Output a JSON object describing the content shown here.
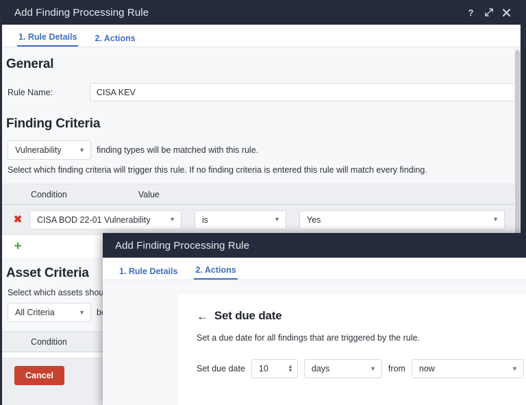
{
  "modal1": {
    "title": "Add Finding Processing Rule",
    "header_icons": [
      {
        "name": "help-icon",
        "glyph": "?"
      },
      {
        "name": "expand-icon",
        "glyph": "↗"
      },
      {
        "name": "close-icon",
        "glyph": "✖"
      }
    ],
    "tabs": [
      {
        "label": "1. Rule Details",
        "active": true
      },
      {
        "label": "2. Actions",
        "active": false
      }
    ],
    "general": {
      "heading": "General",
      "rule_name_label": "Rule Name:",
      "rule_name_value": "CISA KEV",
      "rule_name_placeholder": ""
    },
    "finding_criteria": {
      "heading": "Finding Criteria",
      "type_select": "Vulnerability",
      "type_suffix": "finding types will be matched with this rule.",
      "description": "Select which finding criteria will trigger this rule. If no finding criteria is entered this rule will match every finding.",
      "col_condition": "Condition",
      "col_value": "Value",
      "rows": [
        {
          "remove_label": "✖",
          "condition": "CISA BOD 22-01 Vulnerability",
          "operator": "is",
          "value": "Yes"
        }
      ],
      "add_label": "+"
    },
    "asset_criteria": {
      "heading": "Asset Criteria",
      "description": "Select which assets shou",
      "match_select": "All Criteria",
      "match_suffix": "be",
      "col_condition": "Condition",
      "add_label": "+"
    },
    "footer": {
      "cancel_label": "Cancel"
    }
  },
  "modal2": {
    "title": "Add Finding Processing Rule",
    "tabs": [
      {
        "label": "1. Rule Details",
        "active": false
      },
      {
        "label": "2. Actions",
        "active": true
      }
    ],
    "panel": {
      "back_glyph": "←",
      "title": "Set due date",
      "description": "Set a due date for all findings that are triggered by the rule.",
      "field_label": "Set due date",
      "amount": "10",
      "unit": "days",
      "from_label": "from",
      "anchor": "now"
    }
  },
  "colors": {
    "header_bg": "#242b3c",
    "accent_blue": "#3f6ec0",
    "danger_red": "#c8432f",
    "remove_red": "#cf3b2e",
    "add_green": "#4aa33e"
  }
}
